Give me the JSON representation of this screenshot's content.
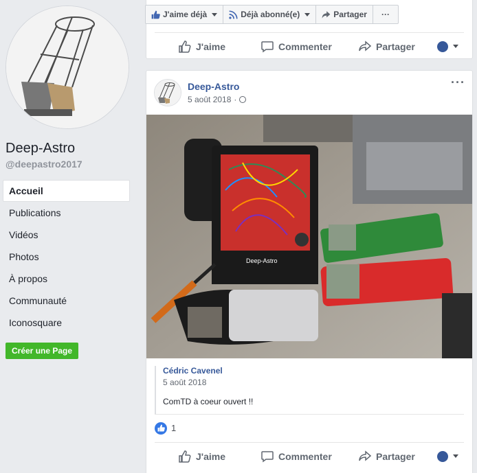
{
  "sidebar": {
    "page_name": "Deep-Astro",
    "handle": "@deepastro2017",
    "nav": [
      {
        "label": "Accueil",
        "active": true
      },
      {
        "label": "Publications"
      },
      {
        "label": "Vidéos"
      },
      {
        "label": "Photos"
      },
      {
        "label": "À propos"
      },
      {
        "label": "Communauté"
      },
      {
        "label": "Iconosquare"
      }
    ],
    "create_page_label": "Créer une Page"
  },
  "top_actions": {
    "like_label": "J'aime déjà",
    "follow_label": "Déjà abonné(e)",
    "share_label": "Partager",
    "more_label": "···"
  },
  "actions": {
    "like": "J'aime",
    "comment": "Commenter",
    "share": "Partager"
  },
  "post": {
    "author": "Deep-Astro",
    "date": "5 août 2018",
    "shared": {
      "author": "Cédric Cavenel",
      "date": "5 août 2018",
      "text": "ComTD à coeur ouvert !!"
    },
    "like_count": "1"
  },
  "colors": {
    "link": "#365899",
    "green": "#42b72a",
    "like_blue": "#3578e5"
  }
}
